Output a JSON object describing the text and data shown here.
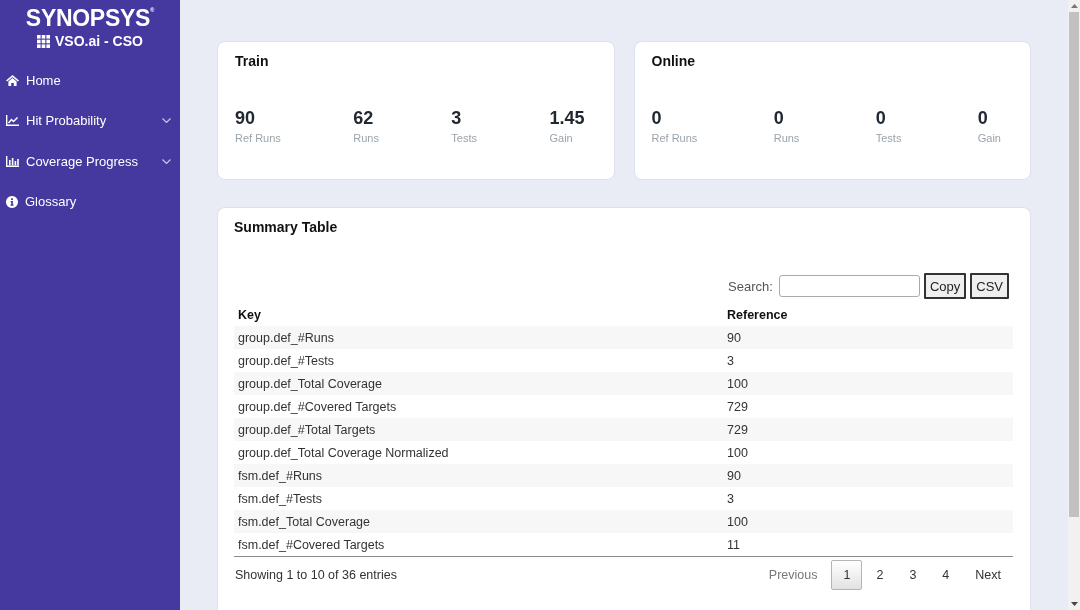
{
  "sidebar": {
    "logo": "SYNOPSYS$^{®}$",
    "product": "VSO.ai - CSO",
    "items": [
      {
        "label": "Home",
        "kind": "link"
      },
      {
        "label": "Hit Probability",
        "kind": "menu"
      },
      {
        "label": "Coverage Progress",
        "kind": "menu"
      },
      {
        "label": "Glossary",
        "kind": "link"
      }
    ]
  },
  "panels": [
    {
      "title": "Train",
      "stats": [
        {
          "value": "90",
          "label": "Ref Runs"
        },
        {
          "value": "62",
          "label": "Runs"
        },
        {
          "value": "3",
          "label": "Tests"
        },
        {
          "value": "1.45",
          "label": "Gain"
        }
      ]
    },
    {
      "title": "Online",
      "stats": [
        {
          "value": "0",
          "label": "Ref Runs"
        },
        {
          "value": "0",
          "label": "Runs"
        },
        {
          "value": "0",
          "label": "Tests"
        },
        {
          "value": "0",
          "label": "Gain"
        }
      ]
    }
  ],
  "summary": {
    "title": "Summary Table",
    "search_label": "Search:",
    "buttons": [
      "Copy",
      "CSV"
    ],
    "columns": [
      "Key",
      "Reference"
    ],
    "rows": [
      [
        "group.def_#Runs",
        "90"
      ],
      [
        "group.def_#Tests",
        "3"
      ],
      [
        "group.def_Total Coverage",
        "100"
      ],
      [
        "group.def_#Covered Targets",
        "729"
      ],
      [
        "group.def_#Total Targets",
        "729"
      ],
      [
        "group.def_Total Coverage Normalized",
        "100"
      ],
      [
        "fsm.def_#Runs",
        "90"
      ],
      [
        "fsm.def_#Tests",
        "3"
      ],
      [
        "fsm.def_Total Coverage",
        "100"
      ],
      [
        "fsm.def_#Covered Targets",
        "11"
      ]
    ],
    "info": "Showing 1 to 10 of 36 entries",
    "pagination": {
      "previous": {
        "label": "Previous",
        "disabled": true
      },
      "pages": [
        {
          "label": "1",
          "selected": true
        },
        {
          "label": "2",
          "selected": false
        },
        {
          "label": "3",
          "selected": false
        },
        {
          "label": "4",
          "selected": false
        }
      ],
      "next": {
        "label": "Next",
        "disabled": false
      }
    }
  }
}
